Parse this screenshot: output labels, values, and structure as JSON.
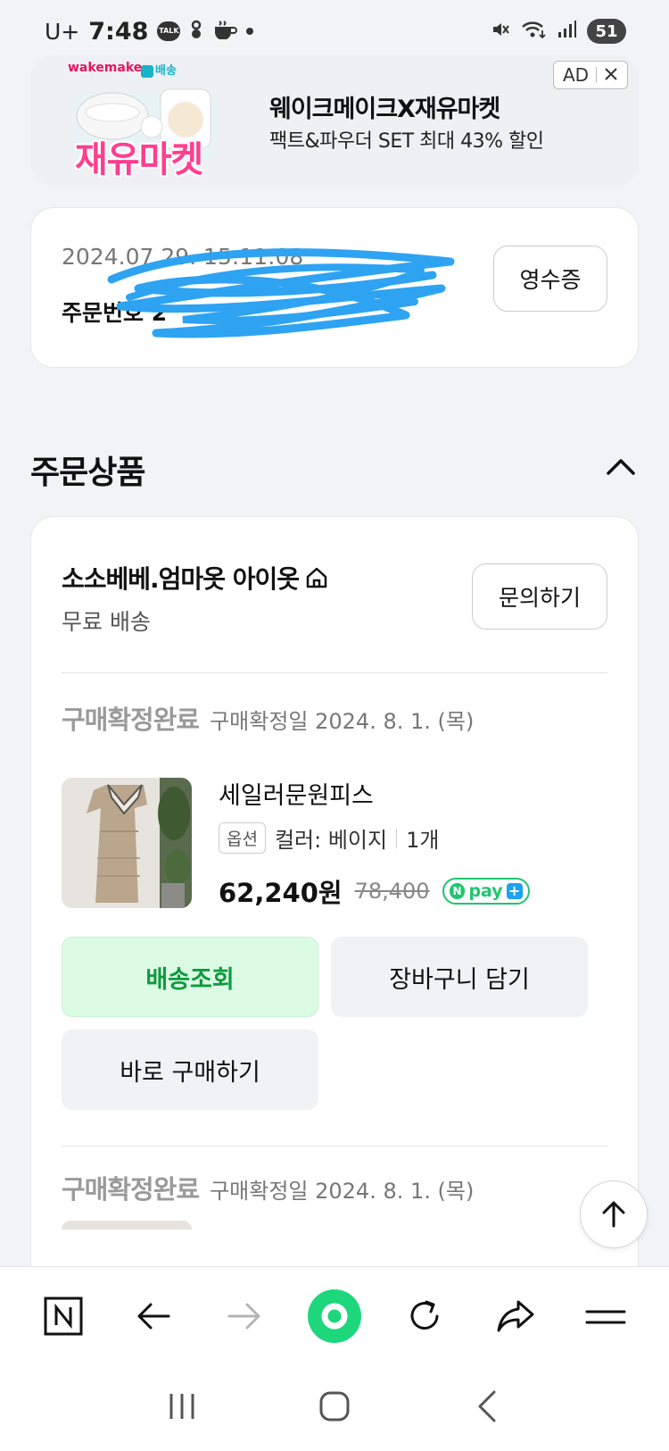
{
  "status_bar": {
    "carrier": "U+",
    "time": "7:48",
    "battery": "51"
  },
  "ad": {
    "brand": "wakemake",
    "shipping_tag": "배송",
    "market_text": "재유마켓",
    "title": "웨이크메이크X재유마켓",
    "subtitle": "팩트&파우더 SET 최대 43% 할인",
    "badge": "AD"
  },
  "order": {
    "date": "2024.07.29. 15:11:08",
    "number_label": "주문번호 2",
    "receipt_label": "영수증"
  },
  "section": {
    "title": "주문상품"
  },
  "store": {
    "name": "소소베베.엄마옷 아이옷",
    "shipping": "무료 배송",
    "inquiry_label": "문의하기"
  },
  "items": [
    {
      "status": "구매확정완료",
      "confirm_date": "구매확정일 2024. 8. 1. (목)",
      "name": "세일러문원피스",
      "option_badge": "옵션",
      "option": "컬러: 베이지",
      "quantity": "1개",
      "price": "62,240원",
      "original_price": "78,400",
      "pay_badge": "pay"
    },
    {
      "status": "구매확정완료",
      "confirm_date": "구매확정일 2024. 8. 1. (목)"
    }
  ],
  "actions": {
    "track": "배송조회",
    "cart": "장바구니 담기",
    "buy_now": "바로 구매하기"
  },
  "colors": {
    "accent_green": "#0f9a3e",
    "green_bg": "#dcfbe5",
    "npay_green": "#1fc56f",
    "ad_pink": "#ff3e8f",
    "scribble_blue": "#2ea3f2"
  }
}
